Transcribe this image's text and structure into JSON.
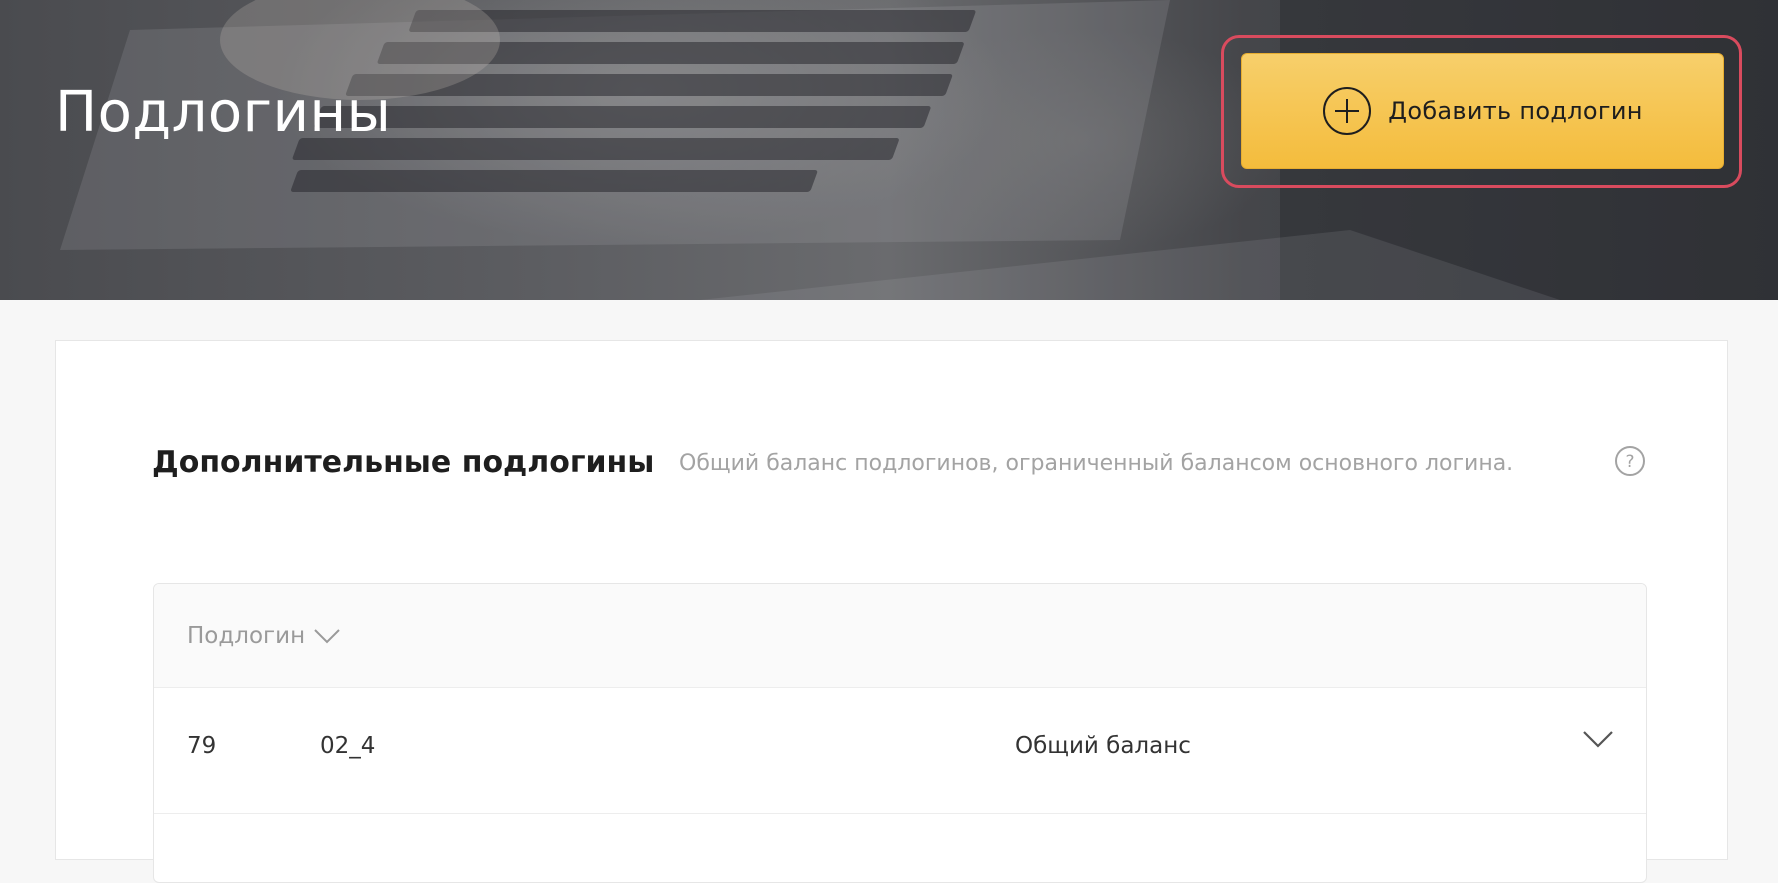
{
  "header": {
    "title": "Подлогины",
    "add_button": {
      "label": "Добавить подлогин",
      "icon": "plus-circle-icon"
    }
  },
  "section": {
    "title": "Дополнительные подлогины",
    "hint": "Общий баланс подлогинов, ограниченный балансом основного логина.",
    "help_icon": "question-circle-icon"
  },
  "table": {
    "sort_header": {
      "label": "Подлогин",
      "icon": "chevron-down-icon"
    },
    "rows": [
      {
        "id": "79",
        "name": "02_4",
        "balance_type": "Общий баланс",
        "toggle_icon": "chevron-down-icon"
      }
    ]
  },
  "colors": {
    "accent_button": "#f4bc3c",
    "highlight_outline": "#d94b5e",
    "muted_text": "#a3a3a3"
  }
}
